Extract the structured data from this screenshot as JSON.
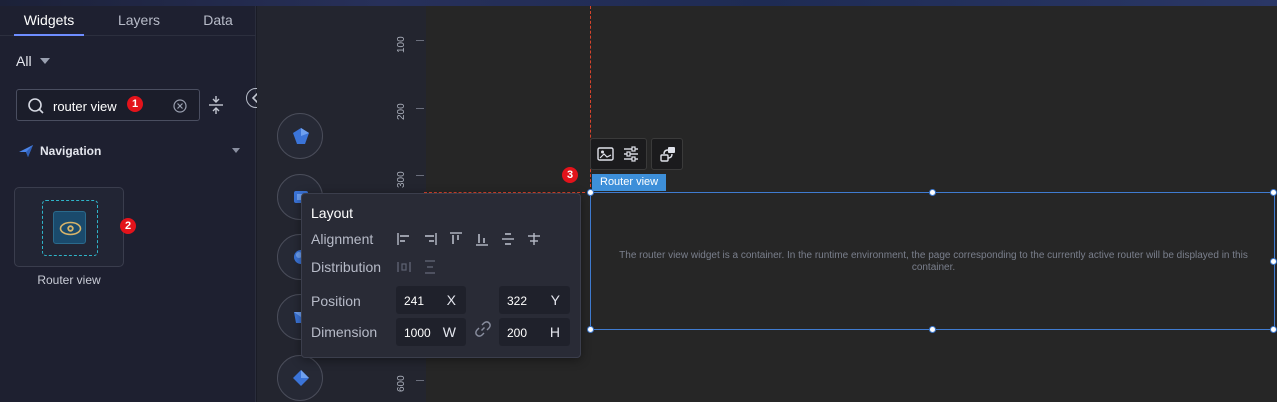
{
  "tabs": [
    {
      "label": "Widgets"
    },
    {
      "label": "Layers"
    },
    {
      "label": "Data"
    }
  ],
  "filter": {
    "label": "All"
  },
  "search": {
    "value": "router view",
    "placeholder": ""
  },
  "badges": [
    "1",
    "2",
    "3"
  ],
  "category": {
    "label": "Navigation"
  },
  "widget": {
    "label": "Router view"
  },
  "ruler": {
    "labels": [
      "100",
      "200",
      "300",
      "600"
    ]
  },
  "selection": {
    "label": "Router view",
    "description": "The router view widget is a container. In the runtime environment, the page corresponding to the currently active router will be displayed in this container."
  },
  "layout_panel": {
    "title": "Layout",
    "alignment_label": "Alignment",
    "distribution_label": "Distribution",
    "position_label": "Position",
    "dimension_label": "Dimension",
    "position_x": "241",
    "position_x_unit": "X",
    "position_y": "322",
    "position_y_unit": "Y",
    "dimension_w": "1000",
    "dimension_w_unit": "W",
    "dimension_h": "200",
    "dimension_h_unit": "H"
  },
  "colors": {
    "accent": "#6e8dff",
    "badge": "#e3131b",
    "selection": "#3d8fd9",
    "guide": "#d8432c"
  }
}
